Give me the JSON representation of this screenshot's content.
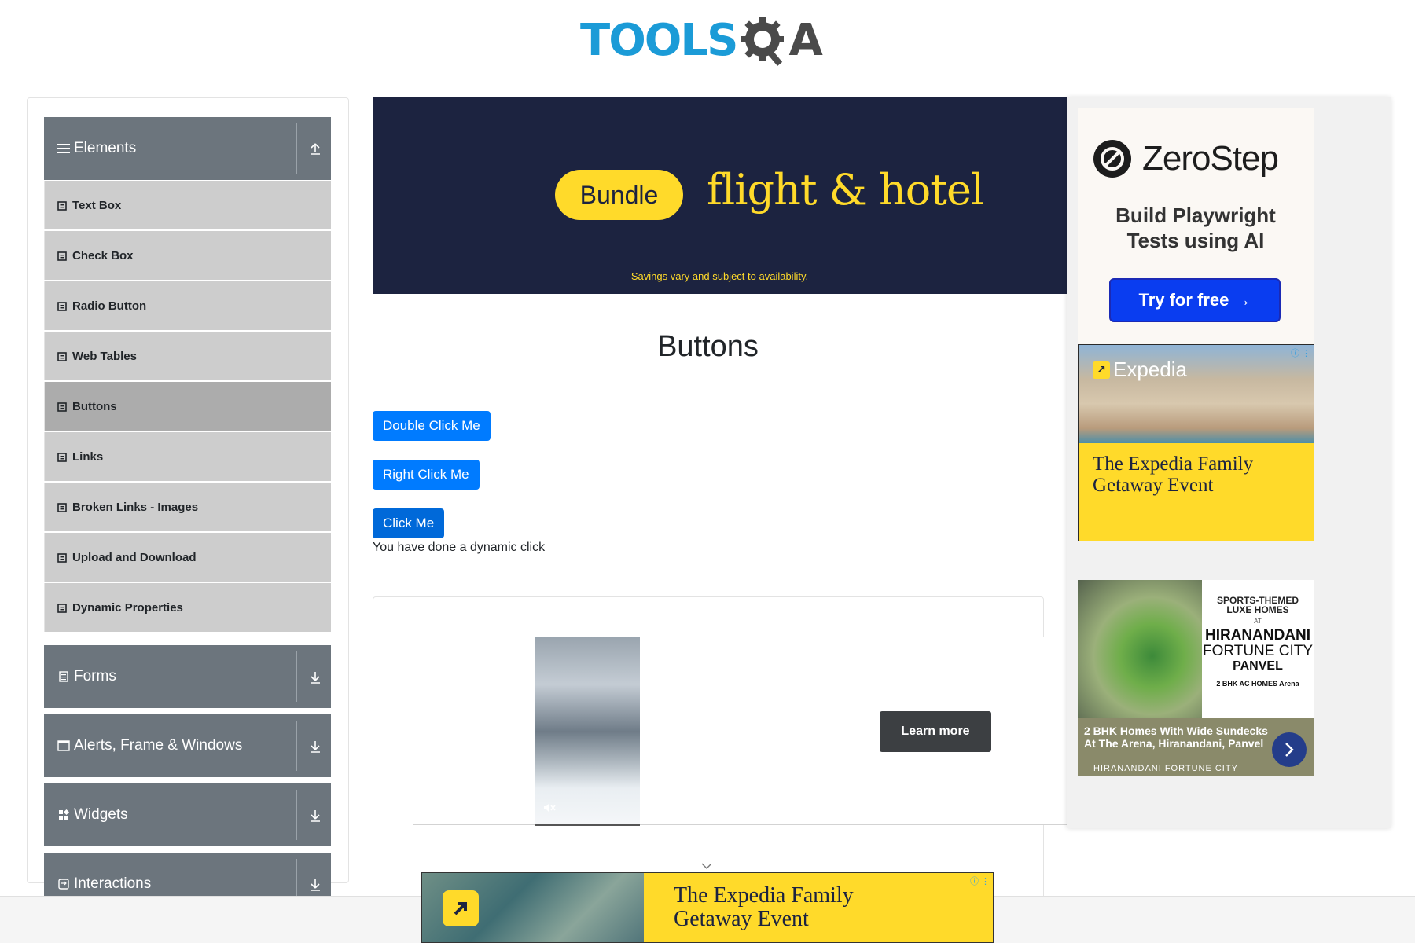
{
  "header": {
    "logo_tools": "TOOLS",
    "logo_qa": "A"
  },
  "sidebar": {
    "groups": [
      {
        "title": "Elements",
        "icon": "hamburger-icon",
        "expanded": true
      },
      {
        "title": "Forms",
        "icon": "form-icon"
      },
      {
        "title": "Alerts, Frame & Windows",
        "icon": "window-icon"
      },
      {
        "title": "Widgets",
        "icon": "widgets-icon"
      },
      {
        "title": "Interactions",
        "icon": "interactions-icon"
      }
    ],
    "items": [
      "Text Box",
      "Check Box",
      "Radio Button",
      "Web Tables",
      "Buttons",
      "Links",
      "Broken Links - Images",
      "Upload and Download",
      "Dynamic Properties"
    ],
    "active_item": "Buttons"
  },
  "banner": {
    "pill": "Bundle",
    "title": "flight & hotel",
    "note": "Savings vary and subject to availability."
  },
  "main": {
    "title": "Buttons",
    "double_click_label": "Double Click Me",
    "right_click_label": "Right Click Me",
    "click_label": "Click Me",
    "dynamic_message": "You have done a dynamic click"
  },
  "video_ad": {
    "cta": "Learn more"
  },
  "ads": {
    "zerostep": {
      "name": "ZeroStep",
      "tagline_1": "Build Playwright",
      "tagline_2": "Tests using AI",
      "cta": "Try for free →"
    },
    "expedia": {
      "brand": "Expedia",
      "line_1": "The Expedia Family",
      "line_2": "Getaway Event"
    },
    "hiranandani": {
      "sports_1": "SPORTS-THEMED",
      "sports_2": "LUXE HOMES",
      "at": "AT",
      "brand": "HIRANANDANI",
      "city": "FORTUNE CITY",
      "panvel": "PANVEL",
      "bhk": "2 BHK AC HOMES",
      "arena": "Arena",
      "headline": "2 BHK Homes With Wide Sundecks At The Arena, Hiranandani, Panvel",
      "footer": "HIRANANDANI FORTUNE CITY"
    },
    "bottom": {
      "line_1": "The Expedia Family",
      "line_2": "Getaway Event"
    }
  },
  "colors": {
    "primary": "#007bff",
    "sidebar_header": "#6c757d",
    "menu_item": "#cdcdcd",
    "menu_active": "#acacac",
    "expedia_yellow": "#ffda2a",
    "banner_navy": "#1c2340"
  }
}
